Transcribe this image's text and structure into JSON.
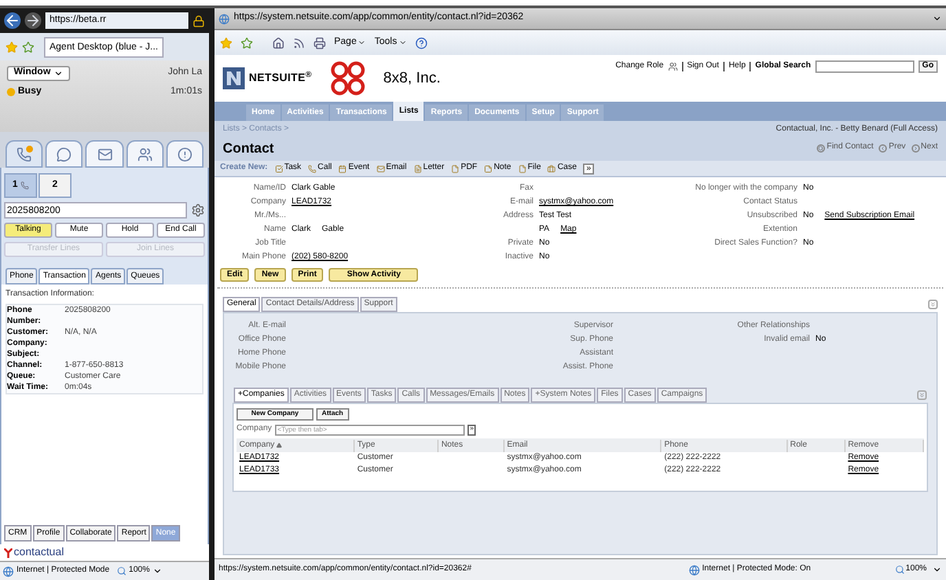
{
  "left_browser": {
    "url": "https://beta.rr",
    "tab_title": "Agent Desktop (blue - J..."
  },
  "agent": {
    "window_menu": "Window",
    "user": "John La",
    "status": "Busy",
    "timer": "1m:01s"
  },
  "channel_tabs": [
    {
      "kind": "phone",
      "selected": true,
      "notification": true
    },
    {
      "kind": "chat",
      "selected": false,
      "notification": false
    },
    {
      "kind": "email",
      "selected": false,
      "notification": false
    },
    {
      "kind": "contacts",
      "selected": false,
      "notification": false
    },
    {
      "kind": "alert",
      "selected": false,
      "notification": false
    }
  ],
  "lines": [
    {
      "label": "1",
      "selected": true,
      "in_call": true
    },
    {
      "label": "2",
      "selected": false,
      "in_call": false
    }
  ],
  "dial_field": {
    "value": "2025808200"
  },
  "call_buttons": [
    {
      "label": "Talking",
      "selected": true
    },
    {
      "label": "Mute",
      "selected": false
    },
    {
      "label": "Hold",
      "selected": false
    },
    {
      "label": "End Call",
      "selected": false
    }
  ],
  "line_buttons": [
    {
      "label": "Transfer Lines",
      "disabled": true
    },
    {
      "label": "Join Lines",
      "disabled": true
    }
  ],
  "panel_tabs": [
    {
      "label": "Phone",
      "selected": false
    },
    {
      "label": "Transaction",
      "selected": true
    },
    {
      "label": "Agents",
      "selected": false
    },
    {
      "label": "Queues",
      "selected": false
    }
  ],
  "transaction": {
    "heading": "Transaction Information:",
    "rows": [
      {
        "label": "Phone Number:",
        "value": "2025808200"
      },
      {
        "label": "Customer:",
        "value": "N/A, N/A"
      },
      {
        "label": "Company:"
      },
      {
        "label": "Subject:"
      },
      {
        "label": "Channel:",
        "value": "1-877-650-8813"
      },
      {
        "label": "Queue:",
        "value": "Customer Care"
      },
      {
        "label": "Wait Time:",
        "value": "0m:04s"
      }
    ]
  },
  "bottom_tabs": [
    {
      "label": "CRM",
      "selected": false
    },
    {
      "label": "Profile",
      "selected": false
    },
    {
      "label": "Collaborate",
      "selected": false
    },
    {
      "label": "Report",
      "selected": false
    },
    {
      "label": "None",
      "selected": true
    }
  ],
  "left_logo": "contactual",
  "left_status": {
    "zone": "Internet | Protected Mode",
    "zoom": "100%"
  },
  "browser": {
    "url": "https://system.netsuite.com/app/common/entity/contact.nl?id=20362",
    "toolbar": [
      "Page",
      "Tools"
    ]
  },
  "header": {
    "brand": "NETSUITE",
    "trademark": "®",
    "company": "8x8, Inc.",
    "links": [
      "Change Role",
      "Sign Out",
      "Help"
    ],
    "search_label": "Global Search",
    "go": "Go"
  },
  "nav_tabs": [
    {
      "label": "Home",
      "selected": false
    },
    {
      "label": "Activities",
      "selected": false
    },
    {
      "label": "Transactions",
      "selected": false
    },
    {
      "label": "Lists",
      "selected": true
    },
    {
      "label": "Reports",
      "selected": false
    },
    {
      "label": "Documents",
      "selected": false
    },
    {
      "label": "Setup",
      "selected": false
    },
    {
      "label": "Support",
      "selected": false
    }
  ],
  "breadcrumb": "Lists > Contacts >",
  "page_title": "Contact",
  "account": "Contactual, Inc. - Betty Benard (Full Access)",
  "record_nav": [
    {
      "kind": "find",
      "label": "Find Contact"
    },
    {
      "kind": "prev",
      "label": "Prev"
    },
    {
      "kind": "next",
      "label": "Next"
    }
  ],
  "create_new": {
    "label": "Create New:",
    "items": [
      {
        "kind": "task",
        "label": "Task"
      },
      {
        "kind": "call",
        "label": "Call"
      },
      {
        "kind": "event",
        "label": "Event"
      },
      {
        "kind": "email",
        "label": "Email"
      },
      {
        "kind": "letter",
        "label": "Letter"
      },
      {
        "kind": "pdf",
        "label": "PDF"
      },
      {
        "kind": "note",
        "label": "Note"
      },
      {
        "kind": "file",
        "label": "File"
      },
      {
        "kind": "case",
        "label": "Case"
      }
    ],
    "more": "»"
  },
  "fields": [
    [
      {
        "label": "Name/ID",
        "lines": [
          [
            {
              "text": "Clark Gable",
              "link": false
            }
          ]
        ]
      },
      {
        "label": "Company",
        "lines": [
          [
            {
              "text": "LEAD1732",
              "link": true
            }
          ]
        ]
      },
      {
        "label": "Mr./Ms..."
      },
      {
        "label": "Name",
        "lines": [
          [
            {
              "text": "Clark",
              "link": false
            },
            {
              "text": "Gable",
              "link": false
            }
          ]
        ]
      },
      {
        "label": "Job Title"
      },
      {
        "label": "Main Phone",
        "lines": [
          [
            {
              "text": "(202) 580-8200",
              "link": true
            }
          ]
        ]
      }
    ],
    [
      {
        "label": "Fax"
      },
      {
        "label": "E-mail",
        "lines": [
          [
            {
              "text": "systmx@yahoo.com",
              "link": true
            }
          ]
        ]
      },
      {
        "label": "Address",
        "lines": [
          [
            {
              "text": "Test Test",
              "link": false
            }
          ],
          [
            {
              "text": "PA",
              "link": false
            },
            {
              "text": "Map",
              "link": true
            }
          ]
        ]
      },
      {
        "label": "Private",
        "lines": [
          [
            {
              "text": "No",
              "link": false
            }
          ]
        ]
      },
      {
        "label": "Inactive",
        "lines": [
          [
            {
              "text": "No",
              "link": false
            }
          ]
        ]
      }
    ],
    [
      {
        "label": "No longer with the company",
        "lines": [
          [
            {
              "text": "No",
              "link": false
            }
          ]
        ]
      },
      {
        "label": "Contact Status"
      },
      {
        "label": "Unsubscribed",
        "lines": [
          [
            {
              "text": "No",
              "link": false
            },
            {
              "text": "Send Subscription Email",
              "link": true
            }
          ]
        ]
      },
      {
        "label": "Extention"
      },
      {
        "label": "Direct Sales Function?",
        "lines": [
          [
            {
              "text": "No",
              "link": false
            }
          ]
        ]
      }
    ]
  ],
  "actions": [
    "Edit",
    "New",
    "Print",
    "Show Activity"
  ],
  "detail_tabs": [
    {
      "label": "General",
      "selected": true
    },
    {
      "label": "Contact Details/Address",
      "selected": false
    },
    {
      "label": "Support",
      "selected": false
    }
  ],
  "general_fields": [
    [
      {
        "label": "Alt. E-mail"
      },
      {
        "label": "Office Phone"
      },
      {
        "label": "Home Phone"
      },
      {
        "label": "Mobile Phone"
      }
    ],
    [
      {
        "label": "Supervisor"
      },
      {
        "label": "Sup. Phone"
      },
      {
        "label": "Assistant"
      },
      {
        "label": "Assist. Phone"
      }
    ],
    [
      {
        "label": "Other Relationships"
      },
      {
        "label": "Invalid email",
        "value": "No"
      }
    ]
  ],
  "sublist_tabs": [
    {
      "label": "+Companies",
      "selected": true
    },
    {
      "label": "Activities",
      "selected": false
    },
    {
      "label": "Events",
      "selected": false
    },
    {
      "label": "Tasks",
      "selected": false
    },
    {
      "label": "Calls",
      "selected": false
    },
    {
      "label": "Messages/Emails",
      "selected": false
    },
    {
      "label": "Notes",
      "selected": false
    },
    {
      "label": "+System Notes",
      "selected": false
    },
    {
      "label": "Files",
      "selected": false
    },
    {
      "label": "Cases",
      "selected": false
    },
    {
      "label": "Campaigns",
      "selected": false
    }
  ],
  "companies": {
    "buttons": [
      "New Company",
      "Attach"
    ],
    "field_label": "Company",
    "placeholder": "<Type then tab>",
    "go": "»",
    "columns": [
      {
        "label": "Company",
        "sorted": true
      },
      {
        "label": "Type",
        "sorted": false
      },
      {
        "label": "Notes",
        "sorted": false
      },
      {
        "label": "Email",
        "sorted": false
      },
      {
        "label": "Phone",
        "sorted": false
      },
      {
        "label": "Role",
        "sorted": false
      },
      {
        "label": "Remove",
        "sorted": false
      }
    ],
    "rows": [
      [
        "LEAD1732",
        "Customer",
        "",
        "systmx@yahoo.com",
        "(222) 222-2222",
        "",
        "Remove"
      ],
      [
        "LEAD1733",
        "Customer",
        "",
        "systmx@yahoo.com",
        "(222) 222-2222",
        "",
        "Remove"
      ]
    ]
  },
  "status_bar": {
    "url": "https://system.netsuite.com/app/common/entity/contact.nl?id=20362#",
    "zone": "Internet | Protected Mode: On",
    "zoom": "100%"
  }
}
